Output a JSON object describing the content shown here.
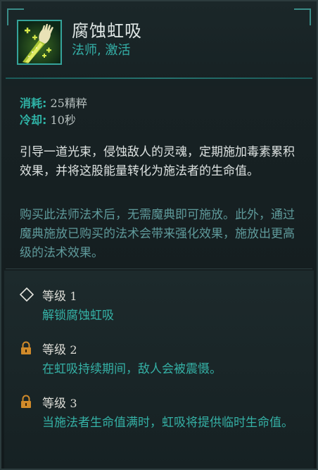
{
  "ability": {
    "name": "腐蚀虹吸",
    "tags": "法师, 激活",
    "icon": "corrosive-siphon-hand-icon"
  },
  "stats": {
    "cost_label": "消耗:",
    "cost_value": "25精粹",
    "cooldown_label": "冷却:",
    "cooldown_value": "10秒"
  },
  "description": "引导一道光束，侵蚀敌人的灵魂，定期施加毒素累积效果，并将这股能量转化为施法者的生命值。",
  "purchase_note": "购买此法师法术后，无需魔典即可施放。此外，通过魔典施放已购买的法术会带来强化效果，施放出更高级的法术效果。",
  "levels": [
    {
      "label": "等级",
      "num": "1",
      "text": "解锁腐蚀虹吸",
      "icon": "diamond-icon",
      "locked": false
    },
    {
      "label": "等级",
      "num": "2",
      "text": "在虹吸持续期间，敌人会被震慑。",
      "icon": "lock-icon",
      "locked": true
    },
    {
      "label": "等级",
      "num": "3",
      "text": "当施法者生命值满时，虹吸将提供临时生命值。",
      "icon": "lock-icon",
      "locked": true
    }
  ],
  "colors": {
    "accent": "#2fb3a6",
    "lock": "#d08a2a",
    "frame": "#35a39b"
  }
}
